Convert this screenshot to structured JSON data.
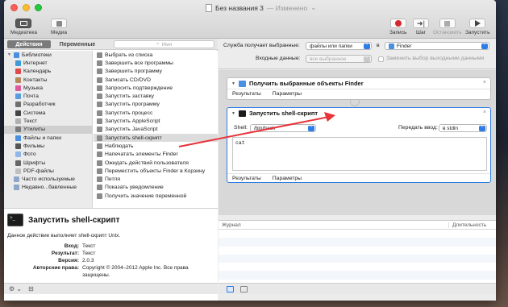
{
  "window": {
    "title": "Без названия 3",
    "edited": "— Изменено",
    "edited_arrow": "⌄"
  },
  "toolbar": {
    "library_label": "Медиатека",
    "media_label": "Медиа",
    "record_label": "Запись",
    "step_label": "Шаг",
    "stop_label": "Остановить",
    "run_label": "Запустить"
  },
  "left": {
    "tab_actions": "Действия",
    "tab_variables": "Переменные",
    "search_placeholder": "Имя",
    "categories": [
      {
        "label": "Библиотеки",
        "icon_color": "#4a8fe0",
        "root": true,
        "expanded": true
      },
      {
        "label": "Интернет",
        "icon_color": "#3e9bd8"
      },
      {
        "label": "Календарь",
        "icon_color": "#e04a4a"
      },
      {
        "label": "Контакты",
        "icon_color": "#b58a58"
      },
      {
        "label": "Музыка",
        "icon_color": "#e05a9a"
      },
      {
        "label": "Почта",
        "icon_color": "#5b9de0"
      },
      {
        "label": "Разработчик",
        "icon_color": "#6f6f6f"
      },
      {
        "label": "Система",
        "icon_color": "#444"
      },
      {
        "label": "Текст",
        "icon_color": "#b0b0b0"
      },
      {
        "label": "Утилиты",
        "icon_color": "#7a7a7a",
        "selected": true
      },
      {
        "label": "Файлы и папки",
        "icon_color": "#4a8fe0"
      },
      {
        "label": "Фильмы",
        "icon_color": "#555"
      },
      {
        "label": "Фото",
        "icon_color": "#8fb8e8"
      },
      {
        "label": "Шрифты",
        "icon_color": "#666"
      },
      {
        "label": "PDF-файлы",
        "icon_color": "#c0c0c0"
      },
      {
        "label": "Часто используемые",
        "icon_color": "#8ea6c8",
        "root": true
      },
      {
        "label": "Недавно...бавленные",
        "icon_color": "#8ea6c8",
        "root": true
      }
    ],
    "actions": [
      {
        "label": "Выбрать из списка"
      },
      {
        "label": "Завершить все программы"
      },
      {
        "label": "Завершить программу"
      },
      {
        "label": "Записать CD/DVD"
      },
      {
        "label": "Запросить подтверждение"
      },
      {
        "label": "Запустить заставку"
      },
      {
        "label": "Запустить программу"
      },
      {
        "label": "Запустить процесс"
      },
      {
        "label": "Запустить AppleScript"
      },
      {
        "label": "Запустить JavaScript"
      },
      {
        "label": "Запустить shell-скрипт",
        "selected": true
      },
      {
        "label": "Наблюдать"
      },
      {
        "label": "Напечатать элементы Finder"
      },
      {
        "label": "Ожидать действий пользователя"
      },
      {
        "label": "Переместить объекты Finder в Корзину"
      },
      {
        "label": "Петля"
      },
      {
        "label": "Показать уведомление"
      },
      {
        "label": "Получить значение переменной"
      }
    ],
    "description": {
      "title": "Запустить shell-скрипт",
      "icon_text": ">_",
      "text": "Данное действие выполняет shell-скрипт Unix.",
      "input_label": "Вход:",
      "input_value": "Текст",
      "result_label": "Результат:",
      "result_value": "Текст",
      "version_label": "Версия:",
      "version_value": "2.0.3",
      "copyright_label": "Авторские права:",
      "copyright_value": "Copyright © 2004–2012 Apple Inc. Все права защищены."
    },
    "bottom_gear": "⚙︎ ⌄",
    "bottom_toggle": "⊟"
  },
  "right": {
    "service_label": "Служба получает выбранные:",
    "service_value": "файлы или папки",
    "in_label": "в",
    "in_value": "Finder",
    "input_label": "Входные данные:",
    "input_value": "все выбранное",
    "replace_label": "Заменить выбор выходными данными",
    "card1": {
      "title": "Получить выбранные объекты Finder",
      "tab_results": "Результаты",
      "tab_params": "Параметры"
    },
    "card2": {
      "title": "Запустить shell-скрипт",
      "shell_label": "Shell:",
      "shell_value": "/bin/bash",
      "pass_label": "Передать ввод:",
      "pass_value": "в stdin",
      "script": "cat",
      "tab_results": "Результаты",
      "tab_params": "Параметры"
    },
    "log_col_journal": "Журнал",
    "log_col_duration": "Длительность",
    "close_glyph": "×"
  },
  "colors": {
    "accent": "#2f7ce7",
    "annotation_arrow": "#e8333a"
  }
}
